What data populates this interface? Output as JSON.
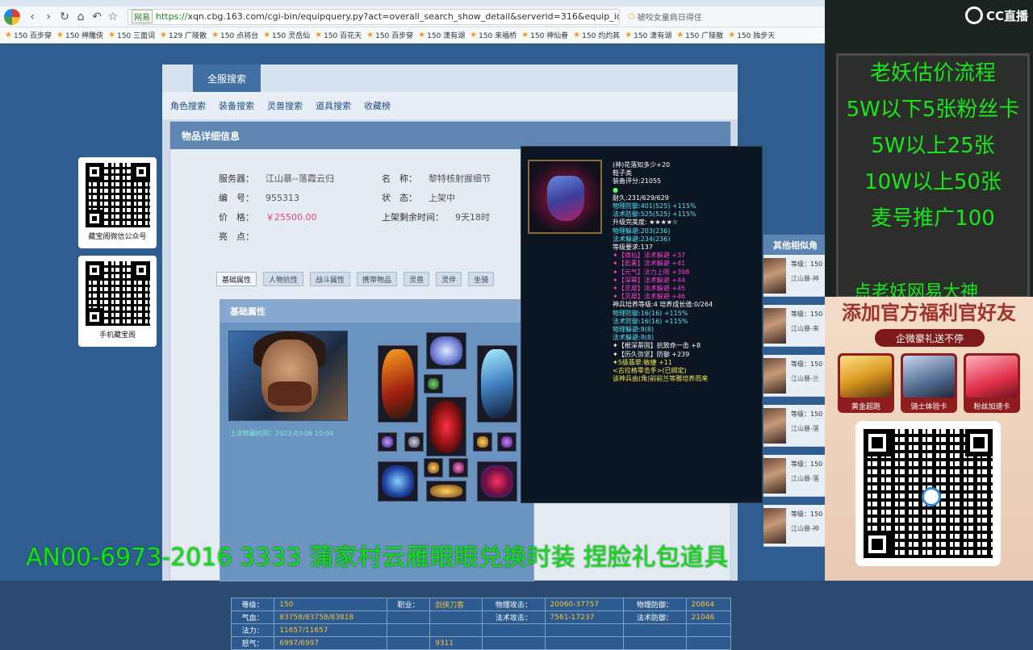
{
  "browser": {
    "url_badge": "网易",
    "url_scheme": "https://",
    "url_rest": "xqn.cbg.163.com/cgi-bin/equipquery.py?act=overall_search_show_detail&serverid=316&equip_id",
    "search_hint": "被咬女童肩日得住",
    "bookmarks": [
      "150 百步穿",
      "150 神雕侠",
      "150 三面词",
      "129 广陵散",
      "150 点将台",
      "150 灵岳仙",
      "150 百花天",
      "150 百步穿",
      "150 潇有湖",
      "150 来福桥",
      "150 神仙眷",
      "150 灼灼其",
      "150 潇有湖",
      "150 广陵散",
      "150 独步天"
    ]
  },
  "page": {
    "tab_all": "全服搜索",
    "sublinks": [
      "角色搜索",
      "装备搜索",
      "灵兽搜索",
      "道具搜索",
      "收藏榜"
    ],
    "detail_title": "物品详细信息",
    "info": {
      "server_label": "服务器：",
      "server_value": "江山暴--落霞云归",
      "name_label": "名　称：",
      "name_value": "黎特核射握细节",
      "id_label": "编　号：",
      "id_value": "955313",
      "status_label": "状　态：",
      "status_value": "上架中",
      "price_label": "价　格：",
      "price_value": "￥25500.00",
      "time_label": "上架剩余时间：",
      "time_value": "9天18时",
      "highlight_label": "亮　点："
    },
    "attr_tabs": [
      "基础属性",
      "人物抗性",
      "战斗属性",
      "携带物品",
      "灵兽",
      "灵伴",
      "坐骑"
    ],
    "attr_title": "基础属性",
    "online_time": "上次称霸时间：2023-03-06 10:04",
    "stats": [
      [
        "等级：",
        "150",
        "职业：",
        "剑侠刀客",
        "物理攻击：",
        "20060-37757",
        "物理防御：",
        "20864"
      ],
      [
        "气血：",
        "83758/83758/83818",
        "",
        "",
        "法术攻击：",
        "7561-17237",
        "法术防御：",
        "21046"
      ],
      [
        "法力：",
        "11657/11657",
        "",
        "",
        "",
        "",
        "",
        ""
      ],
      [
        "怒气：",
        "6997/6997",
        "",
        "9311",
        "",
        "",
        "",
        ""
      ]
    ]
  },
  "qr_cards": [
    {
      "label": "藏宝阁微信公众号"
    },
    {
      "label": "手机藏宝阁"
    }
  ],
  "similar": {
    "title": "其他相似角",
    "items": [
      {
        "level": "等级：150",
        "server": "江山暴-神"
      },
      {
        "level": "等级：150",
        "server": "江山暴-来"
      },
      {
        "level": "等级：150",
        "server": "江山暴-兰"
      },
      {
        "level": "等级：150",
        "server": "江山暴-落"
      },
      {
        "level": "等级：150",
        "server": "江山暴-落"
      },
      {
        "level": "等级：150",
        "server": "江山暴-神"
      }
    ]
  },
  "tooltip": {
    "lines": [
      {
        "t": "(神)花落知多少+20",
        "c": "c-white"
      },
      {
        "t": "鞋子类",
        "c": "c-white"
      },
      {
        "t": "装备评分:21055",
        "c": "c-white"
      },
      {
        "t": "●",
        "c": "c-green"
      },
      {
        "t": "耐久:231/629/629",
        "c": "c-white"
      },
      {
        "t": "物理防御:401(525) +115%",
        "c": "c-cyan"
      },
      {
        "t": "法术防御:525(525) +115%",
        "c": "c-cyan"
      },
      {
        "t": "升级完美度: ★★★★☆",
        "c": "c-white"
      },
      {
        "t": "物理躲避:203(236)",
        "c": "c-cyan"
      },
      {
        "t": "法术躲避:234(236)",
        "c": "c-cyan"
      },
      {
        "t": "等级要求:137",
        "c": "c-white"
      },
      {
        "t": " ",
        "c": "c-white"
      },
      {
        "t": "✦【谪仙】法术躲避 +37",
        "c": "c-pink"
      },
      {
        "t": "✦【若素】法术躲避 +41",
        "c": "c-pink"
      },
      {
        "t": "✦【元气】法力上限 +398",
        "c": "c-pink"
      },
      {
        "t": "✦【深幂】法术躲避 +44",
        "c": "c-pink"
      },
      {
        "t": "✦【灵犀】法术躲避 +45",
        "c": "c-pink"
      },
      {
        "t": "✦【灵犀】法术躲避 +46",
        "c": "c-pink"
      },
      {
        "t": " ",
        "c": "c-white"
      },
      {
        "t": "神兵培养等级:4 培养成长值:0/264",
        "c": "c-white"
      },
      {
        "t": "物理防御:16(16) +115%",
        "c": "c-cyan"
      },
      {
        "t": "法术防御:16(16) +115%",
        "c": "c-cyan"
      },
      {
        "t": "物理躲避:8(8)",
        "c": "c-cyan"
      },
      {
        "t": "法术躲避:8(8)",
        "c": "c-cyan"
      },
      {
        "t": "✦【根深蒂固】抗致命一击 +8",
        "c": "c-white"
      },
      {
        "t": "✦【历久弥坚】防御 +239",
        "c": "c-white"
      },
      {
        "t": " ",
        "c": "c-white"
      },
      {
        "t": "✦5级翡翠:敏捷 +11",
        "c": "c-yellow"
      },
      {
        "t": " ",
        "c": "c-white"
      },
      {
        "t": "<古拉格零击手>(已绑定)",
        "c": "c-yellow"
      },
      {
        "t": " ",
        "c": "c-white"
      },
      {
        "t": "该神兵由(角)前前兰等雅培养而来",
        "c": "c-yellow"
      }
    ]
  },
  "stream": {
    "ticker": "AN00-6973-2016 3333 蒲家村云雁眼眼兑换时装 捏脸礼包道具",
    "mid_text": "点老妖网易大神",
    "brand": "CC直播",
    "price_board": [
      "老妖估价流程",
      "5W以下5张粉丝卡",
      "5W以上25张",
      "10W以上50张",
      "麦号推广100"
    ],
    "promo_title": "添加官方福利官好友",
    "promo_sub": "企微豪礼送不停",
    "promo_cards": [
      "黄金超跑",
      "骑士体验卡",
      "粉丝加速卡"
    ]
  }
}
